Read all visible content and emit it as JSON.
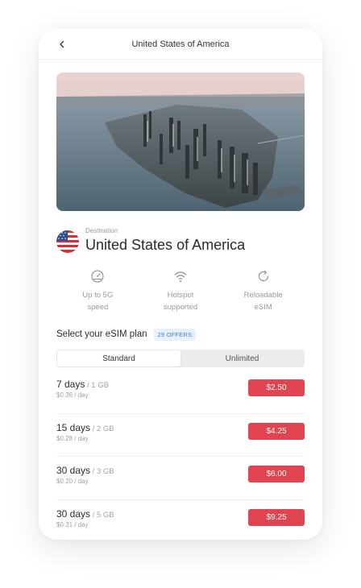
{
  "header": {
    "title": "United States of America"
  },
  "destination": {
    "label": "Destination",
    "name": "United States of America"
  },
  "features": [
    {
      "icon": "speedometer-icon",
      "line1": "Up to 5G",
      "line2": "speed"
    },
    {
      "icon": "wifi-icon",
      "line1": "Hotspot",
      "line2": "supported"
    },
    {
      "icon": "reload-icon",
      "line1": "Reloadable",
      "line2": "eSIM"
    }
  ],
  "plans_section": {
    "title": "Select your eSIM plan",
    "offers_badge": "29 OFFERS",
    "tabs": [
      {
        "label": "Standard",
        "active": true
      },
      {
        "label": "Unlimited",
        "active": false
      }
    ]
  },
  "plans": [
    {
      "days": "7 days",
      "data": " / 1 GB",
      "per_day": "$0.36 / day",
      "price": "$2.50"
    },
    {
      "days": "15 days",
      "data": " / 2 GB",
      "per_day": "$0.28 / day",
      "price": "$4.25"
    },
    {
      "days": "30 days",
      "data": " / 3 GB",
      "per_day": "$0.20 / day",
      "price": "$6.00"
    },
    {
      "days": "30 days",
      "data": " / 5 GB",
      "per_day": "$0.31 / day",
      "price": "$9.25"
    }
  ],
  "colors": {
    "accent": "#e04450",
    "badge_bg": "#e7f1fd",
    "badge_text": "#3b82d6"
  }
}
